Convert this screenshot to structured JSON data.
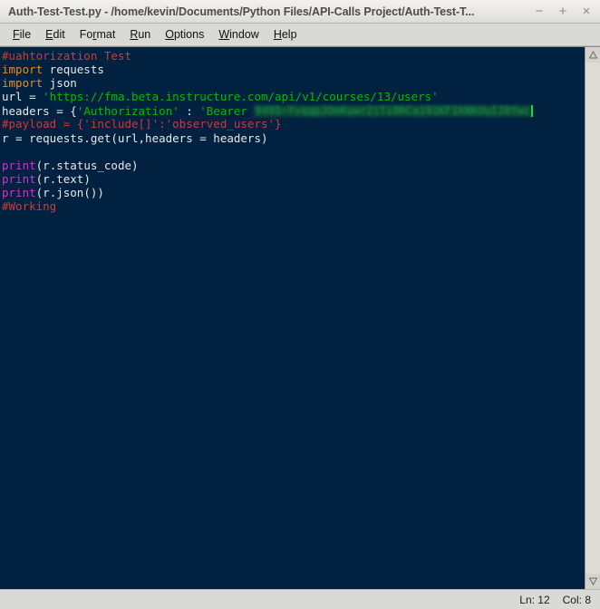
{
  "window": {
    "title": "Auth-Test-Test.py - /home/kevin/Documents/Python Files/API-Calls Project/Auth-Test-T...",
    "minimize_label": "−",
    "maximize_label": "+",
    "close_label": "×"
  },
  "menubar": {
    "items": [
      {
        "id": "file",
        "pre": "",
        "mnemonic": "F",
        "post": "ile"
      },
      {
        "id": "edit",
        "pre": "",
        "mnemonic": "E",
        "post": "dit"
      },
      {
        "id": "format",
        "pre": "Fo",
        "mnemonic": "r",
        "post": "mat"
      },
      {
        "id": "run",
        "pre": "",
        "mnemonic": "R",
        "post": "un"
      },
      {
        "id": "options",
        "pre": "",
        "mnemonic": "O",
        "post": "ptions"
      },
      {
        "id": "window",
        "pre": "",
        "mnemonic": "W",
        "post": "indow"
      },
      {
        "id": "help",
        "pre": "",
        "mnemonic": "H",
        "post": "elp"
      }
    ]
  },
  "editor": {
    "background_color": "#002240",
    "colors": {
      "comment": "#d03a38",
      "keyword": "#ee8b1f",
      "string": "#00bb00",
      "builtin": "#d431d4",
      "plain": "#e8e8e8",
      "caret": "#18d84a"
    },
    "lines": [
      {
        "n": 1,
        "segments": [
          {
            "type": "comment",
            "text": "#uahtorization Test"
          }
        ]
      },
      {
        "n": 2,
        "segments": [
          {
            "type": "keyword",
            "text": "import"
          },
          {
            "type": "plain",
            "text": " requests"
          }
        ]
      },
      {
        "n": 3,
        "segments": [
          {
            "type": "keyword",
            "text": "import"
          },
          {
            "type": "plain",
            "text": " json"
          }
        ]
      },
      {
        "n": 4,
        "segments": [
          {
            "type": "plain",
            "text": "url = "
          },
          {
            "type": "string",
            "text": "'https://fma.beta.instructure.com/api/v1/courses/13/users'"
          }
        ]
      },
      {
        "n": 5,
        "segments": [
          {
            "type": "plain",
            "text": "headers = {"
          },
          {
            "type": "string",
            "text": "'Authorization'"
          },
          {
            "type": "plain",
            "text": " : "
          },
          {
            "type": "string",
            "text": "'Bearer "
          },
          {
            "type": "redacted",
            "text": "9495~YvqqpJOeKuwr2iTi0RCa191KF1kNkUuIJ8Ywc"
          },
          {
            "type": "caret",
            "text": ""
          }
        ]
      },
      {
        "n": 6,
        "segments": [
          {
            "type": "comment",
            "text": "#payload = {'include[]':'observed_users'}"
          }
        ]
      },
      {
        "n": 7,
        "segments": [
          {
            "type": "plain",
            "text": "r = requests.get(url,headers = headers)"
          }
        ]
      },
      {
        "n": 8,
        "segments": [
          {
            "type": "plain",
            "text": ""
          }
        ]
      },
      {
        "n": 9,
        "segments": [
          {
            "type": "builtin",
            "text": "print"
          },
          {
            "type": "plain",
            "text": "(r.status_code)"
          }
        ]
      },
      {
        "n": 10,
        "segments": [
          {
            "type": "builtin",
            "text": "print"
          },
          {
            "type": "plain",
            "text": "(r.text)"
          }
        ]
      },
      {
        "n": 11,
        "segments": [
          {
            "type": "builtin",
            "text": "print"
          },
          {
            "type": "plain",
            "text": "(r.json())"
          }
        ]
      },
      {
        "n": 12,
        "segments": [
          {
            "type": "comment",
            "text": "#Working"
          }
        ]
      }
    ]
  },
  "scrollbar": {
    "up_arrow": "scroll-up-arrow",
    "down_arrow": "scroll-down-arrow"
  },
  "statusbar": {
    "line_label": "Ln: 12",
    "col_label": "Col: 8"
  }
}
